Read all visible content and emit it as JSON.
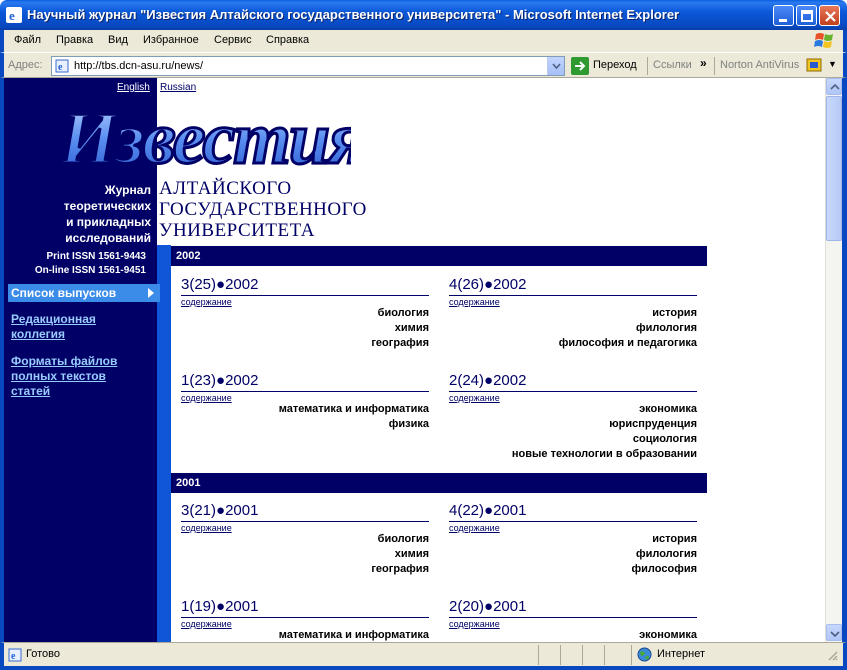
{
  "window": {
    "title": "Научный журнал \"Известия Алтайского государственного университета\" - Microsoft Internet Explorer"
  },
  "menu": [
    "Файл",
    "Правка",
    "Вид",
    "Избранное",
    "Сервис",
    "Справка"
  ],
  "address": {
    "label": "Адрес:",
    "url": "http://tbs.dcn-asu.ru/news/",
    "go_label": "Переход",
    "links_label": "Ссылки",
    "chevron": "»",
    "norton_label": "Norton AntiVirus"
  },
  "page": {
    "lang_en": "English",
    "lang_ru": "Russian",
    "logo_text": "Известия",
    "subtitle": [
      "Журнал",
      "теоретических",
      "и прикладных",
      "исследований"
    ],
    "university": [
      "Алтайского",
      "государственного",
      "университета"
    ],
    "issn_print": "Print ISSN 1561-9443",
    "issn_online": "On-line ISSN 1561-9451",
    "nav": {
      "active": "Список выпусков",
      "board": "Редакционная коллегия",
      "formats": "Форматы файлов полных текстов статей"
    },
    "contents_label": "содержание",
    "years": [
      {
        "year": "2002",
        "issues": [
          {
            "num": "3(25)●2002",
            "topics": [
              "биология",
              "химия",
              "география"
            ]
          },
          {
            "num": "4(26)●2002",
            "topics": [
              "история",
              "филология",
              "философия и педагогика"
            ]
          },
          {
            "num": "1(23)●2002",
            "topics": [
              "математика и информатика",
              "физика"
            ]
          },
          {
            "num": "2(24)●2002",
            "topics": [
              "экономика",
              "юриспруденция",
              "социология",
              "новые технологии в образовании"
            ]
          }
        ]
      },
      {
        "year": "2001",
        "issues": [
          {
            "num": "3(21)●2001",
            "topics": [
              "биология",
              "химия",
              "география"
            ]
          },
          {
            "num": "4(22)●2001",
            "topics": [
              "история",
              "филология",
              "философия"
            ]
          },
          {
            "num": "1(19)●2001",
            "topics": [
              "математика и информатика"
            ]
          },
          {
            "num": "2(20)●2001",
            "topics": [
              "экономика"
            ]
          }
        ]
      }
    ]
  },
  "status": {
    "text": "Готово",
    "zone": "Интернет"
  },
  "colors": {
    "navy": "#000066",
    "accent_blue": "#3b8be8",
    "link_light": "#99ccff"
  }
}
